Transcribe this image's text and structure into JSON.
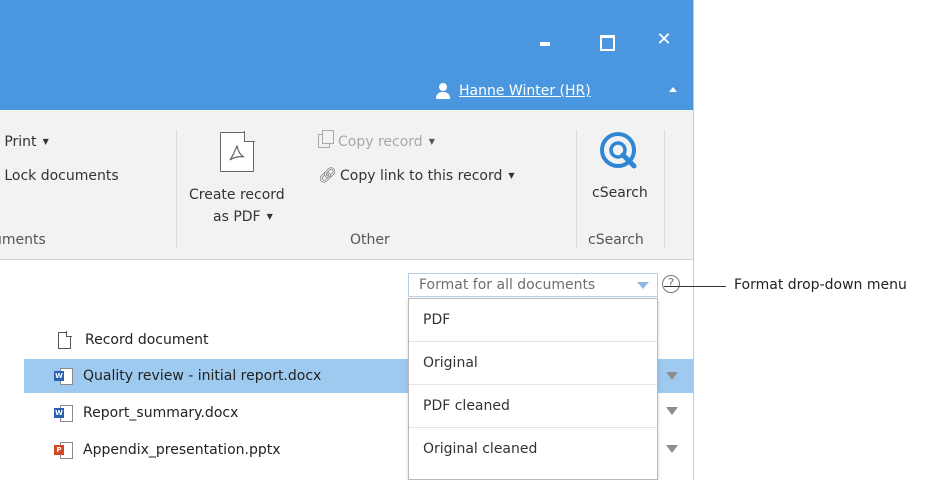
{
  "window": {
    "minimize_icon": "minimize-icon",
    "maximize_icon": "maximize-icon",
    "close_glyph": "✕",
    "accent_color": "#4a97df"
  },
  "user": {
    "name": "Hanne Winter (HR)",
    "icon": "user-icon",
    "collapse_icon": "chevron-up-icon"
  },
  "ribbon": {
    "documents": {
      "print_label": "Print",
      "lock_label": "Lock documents",
      "group_label": "ıments"
    },
    "other": {
      "create_pdf_line1": "Create record",
      "create_pdf_line2": "as PDF",
      "copy_record_label": "Copy record",
      "copy_link_label": "Copy link to this record",
      "group_label": "Other"
    },
    "csearch": {
      "button_label": "cSearch",
      "group_label": "cSearch",
      "icon": "csearch-icon"
    }
  },
  "format_menu": {
    "button_label": "Format for all documents",
    "help_glyph": "?",
    "options": [
      "PDF",
      "Original",
      "PDF cleaned",
      "Original cleaned"
    ]
  },
  "documents": [
    {
      "name": "Record document",
      "icon": "record-document-icon",
      "selected": false
    },
    {
      "name": "Quality review - initial report.docx",
      "icon": "word-icon",
      "selected": true
    },
    {
      "name": "Report_summary.docx",
      "icon": "word-icon",
      "selected": false
    },
    {
      "name": "Appendix_presentation.pptx",
      "icon": "powerpoint-icon",
      "selected": false
    }
  ],
  "callout": {
    "label": "Format drop-down menu"
  },
  "colors": {
    "title_bar": "#4a97df",
    "selection": "#9fcaf0",
    "ribbon_bg": "#f2f2f2"
  }
}
